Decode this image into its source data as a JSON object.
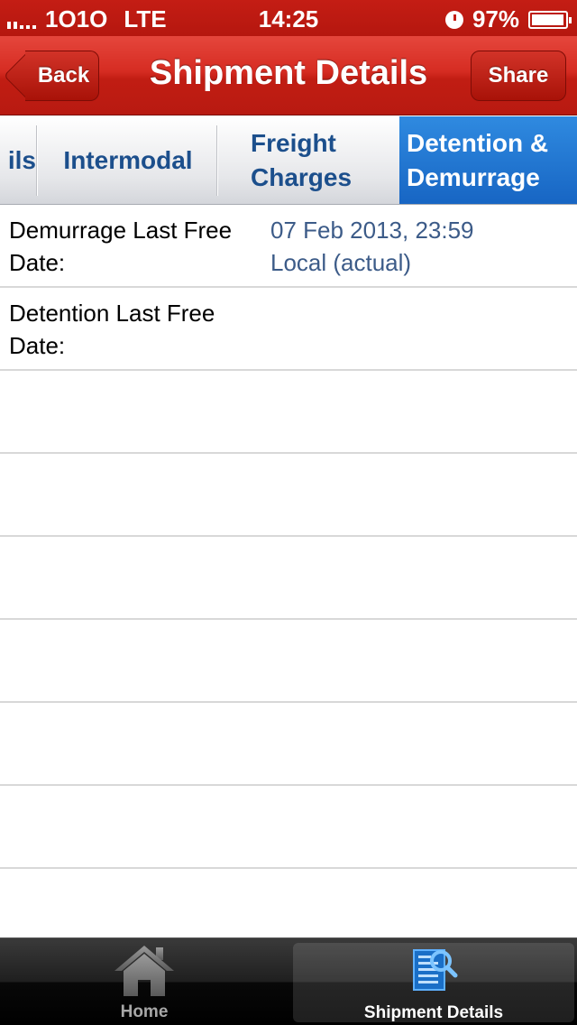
{
  "status_bar": {
    "carrier": "1O1O",
    "network": "LTE",
    "time": "14:25",
    "battery": "97%",
    "battery_level": 0.97
  },
  "nav": {
    "title": "Shipment Details",
    "back_label": "Back",
    "share_label": "Share"
  },
  "tabs": [
    {
      "label": "ils",
      "selected": false
    },
    {
      "label": "Intermodal",
      "selected": false
    },
    {
      "label": "Freight\nCharges",
      "selected": false
    },
    {
      "label": "Detention &\nDemurrage",
      "selected": true
    }
  ],
  "rows": [
    {
      "label": "Demurrage Last Free\nDate:",
      "value": "07 Feb 2013, 23:59\nLocal  (actual)"
    },
    {
      "label": "Detention Last Free\nDate:",
      "value": ""
    }
  ],
  "tab_bar": {
    "items": [
      {
        "label": "Home",
        "icon": "home-icon",
        "selected": false
      },
      {
        "label": "Shipment Details",
        "icon": "shipment-details-icon",
        "selected": true
      }
    ]
  },
  "colors": {
    "nav_red": "#c41d14",
    "tab_text_blue": "#1c4f8c",
    "selected_tab_blue": "#1f74d0",
    "value_blue": "#3c5b88"
  }
}
